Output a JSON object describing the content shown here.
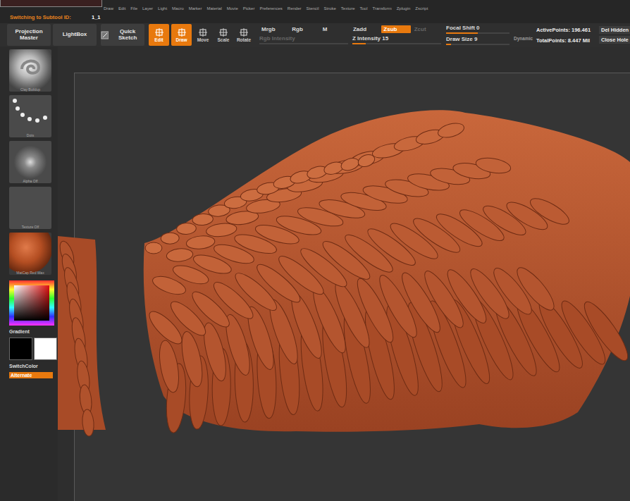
{
  "menu": [
    "Draw",
    "Edit",
    "File",
    "Layer",
    "Light",
    "Macro",
    "Marker",
    "Material",
    "Movie",
    "Picker",
    "Preferences",
    "Render",
    "Stencil",
    "Stroke",
    "Texture",
    "Tool",
    "Transform",
    "Zplugin",
    "Zscript"
  ],
  "subtool": {
    "label": "Switching to Subtool ID:",
    "value": "1_1"
  },
  "toolbar": {
    "buttons": [
      {
        "label": "Projection Master",
        "kind": "text"
      },
      {
        "label": "LightBox",
        "kind": "text"
      },
      {
        "label": "Quick Sketch",
        "kind": "icon"
      }
    ],
    "modes": [
      {
        "label": "Edit",
        "selected": true,
        "kind": "big"
      },
      {
        "label": "Draw",
        "selected": true,
        "kind": "big"
      },
      {
        "label": "Move",
        "selected": false,
        "kind": "small"
      },
      {
        "label": "Scale",
        "selected": false,
        "kind": "small"
      },
      {
        "label": "Rotate",
        "selected": false,
        "kind": "small"
      }
    ],
    "channels": [
      {
        "label": "Mrgb",
        "selected": false,
        "disabled": false
      },
      {
        "label": "Rgb",
        "selected": false,
        "disabled": false
      },
      {
        "label": "M",
        "selected": false,
        "disabled": false
      },
      {
        "label": "Zadd",
        "selected": false,
        "disabled": false
      },
      {
        "label": "Zsub",
        "selected": true,
        "disabled": false
      },
      {
        "label": "Zcut",
        "selected": false,
        "disabled": true
      }
    ],
    "rgb_intensity": {
      "label": "Rgb Intensity",
      "disabled": true
    },
    "z_intensity": {
      "label": "Z Intensity",
      "value": "15",
      "level": 0.15
    },
    "focal_shift": {
      "label": "Focal Shift",
      "value": "0",
      "level": 0.5
    },
    "draw_size": {
      "label": "Draw Size",
      "value": "9",
      "level": 0.08
    },
    "dynamic": {
      "label": "Dynamic",
      "on": false
    },
    "stats": [
      {
        "label": "ActivePoints:",
        "value": "196.461"
      },
      {
        "label": "TotalPoints:",
        "value": "8.447 Mil"
      }
    ],
    "actions": [
      "Del Hidden",
      "Close Hole"
    ]
  },
  "sidebar": {
    "thumbs": [
      {
        "label": "Clay Buildup",
        "kind": "brush"
      },
      {
        "label": "Dots",
        "kind": "stroke"
      },
      {
        "label": "Alpha Off",
        "kind": "alpha"
      },
      {
        "label": "Texture Off",
        "kind": "texture"
      },
      {
        "label": "MatCap Red Wax",
        "kind": "material"
      }
    ],
    "gradient": "Gradient",
    "main_color": "#000000",
    "secondary_color": "#ffffff",
    "switch_color": "SwitchColor",
    "alternate": {
      "label": "Alternate",
      "on": true
    }
  }
}
